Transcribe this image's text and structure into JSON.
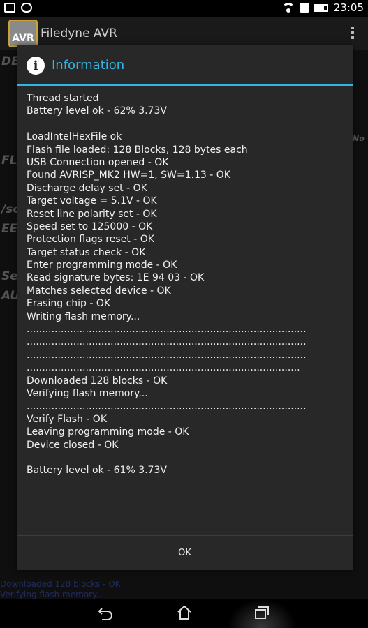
{
  "status_bar": {
    "time": "23:05"
  },
  "app_bar": {
    "icon_text": "AVR",
    "title": "Filedyne AVR"
  },
  "background": {
    "fragments": [
      "DE",
      "FLA",
      "/sc",
      "EE",
      "Se",
      "AU",
      "No"
    ],
    "log_tail": [
      "Downloaded 128 blocks - OK",
      "Verifying flash memory..."
    ]
  },
  "dialog": {
    "title": "Information",
    "lines": [
      "Thread started",
      "Battery level ok - 62% 3.73V",
      "",
      "LoadIntelHexFile ok",
      "Flash file loaded: 128 Blocks, 128 bytes each",
      "USB Connection opened - OK",
      "Found AVRISP_MK2 HW=1, SW=1.13 - OK",
      "Discharge delay set - OK",
      "Target voltage = 5.1V - OK",
      "Reset line polarity set - OK",
      "Speed set to 125000 - OK",
      "Protection flags reset - OK",
      "Target status check - OK",
      "Enter programming mode - OK",
      "Read signature bytes: 1E 94 03 - OK",
      "Matches selected device - OK",
      "Erasing chip - OK",
      "Writing flash memory...",
      "..........................................................................................",
      "..........................................................................................",
      "..........................................................................................",
      "........................................................................................",
      "Downloaded 128 blocks - OK",
      "Verifying flash memory...",
      "..........................................................................................",
      "Verify Flash - OK",
      "Leaving programming mode - OK",
      "Device closed - OK",
      "",
      "Battery level ok - 61% 3.73V"
    ],
    "ok_label": "OK"
  }
}
